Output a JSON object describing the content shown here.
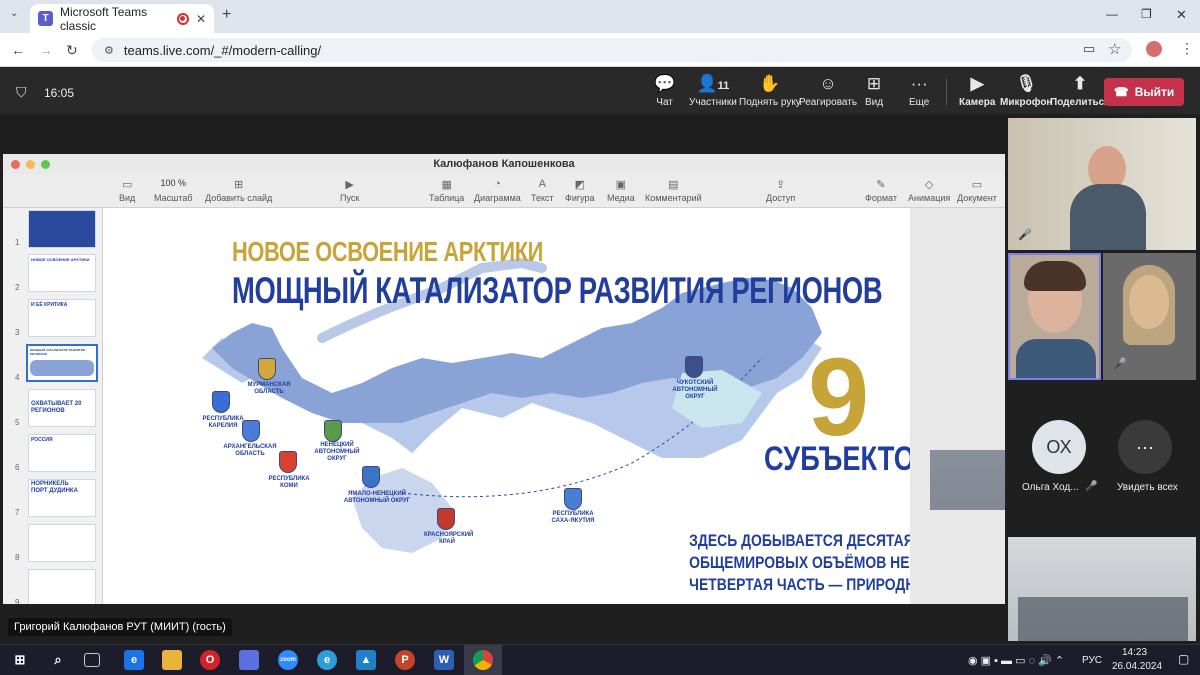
{
  "browser": {
    "tab_title": "Microsoft Teams classic",
    "new_tab": "+",
    "url": "teams.live.com/_#/modern-calling/"
  },
  "meeting": {
    "time": "16:05",
    "participants_count": "11",
    "controls": {
      "chat": "Чат",
      "participants": "Участники",
      "raise_hand": "Поднять руку",
      "react": "Реагировать",
      "view": "Вид",
      "more": "Еще",
      "camera": "Камера",
      "mic": "Микрофон",
      "share": "Поделиться",
      "leave": "Выйти"
    },
    "presenter_label": "Григорий Калюфанов РУТ (МИИТ) (гость)",
    "participants": {
      "initials": "ОХ",
      "name": "Ольга Ход...",
      "see_all": "Увидеть всех"
    }
  },
  "keynote": {
    "window_title": "Калюфанов Капошенкова",
    "zoom": "100 %",
    "toolbar": {
      "view": "Вид",
      "zoom_label": "Масштаб",
      "add_slide": "Добавить слайд",
      "play": "Пуск",
      "table": "Таблица",
      "chart": "Диаграмма",
      "text": "Текст",
      "shape": "Фигура",
      "media": "Медиа",
      "comment": "Комментарий",
      "share": "Доступ",
      "format": "Формат",
      "animate": "Анимация",
      "document": "Документ"
    },
    "slide_numbers": [
      "1",
      "2",
      "3",
      "4",
      "5",
      "6",
      "7",
      "8",
      "9"
    ],
    "thumbnails": {
      "t2": "НОВОЕ ОСВОЕНИЕ АРКТИКИ",
      "t3": "И ЕЁ КРИТИКА",
      "t4": "МОЩНЫЙ КАТАЛИЗАТОР РАЗВИТИЯ РЕГИОНОВ",
      "t5a": "ОХВАТЫВАЕТ 20",
      "t5b": "РЕГИОНОВ",
      "t6": "РОССИЯ",
      "t7a": "НОРНИКЕЛЬ",
      "t7b": "ПОРТ ДУДИНКА"
    }
  },
  "slide": {
    "heading1": "НОВОЕ ОСВОЕНИЕ АРКТИКИ",
    "heading2": "МОЩНЫЙ КАТАЛИЗАТОР РАЗВИТИЯ РЕГИОНОВ",
    "big_number": "9",
    "subjects": "СУБЪЕКТОВ",
    "fact_line1": "ЗДЕСЬ ДОБЫВАЕТСЯ ДЕСЯТАЯ ЧАСТЬ",
    "fact_line2": "ОБЩЕМИРОВЫХ ОБЪЁМОВ НЕФТИ И",
    "fact_line3": "ЧЕТВЕРТАЯ ЧАСТЬ — ПРИРОДНОГО ГАЗА",
    "regions": {
      "murmansk": "МУРМАНСКАЯ ОБЛАСТЬ",
      "karelia": "РЕСПУБЛИКА КАРЕЛИЯ",
      "arkhangelsk": "АРХАНГЕЛЬСКАЯ ОБЛАСТЬ",
      "komi": "РЕСПУБЛИКА КОМИ",
      "nenets": "НЕНЕЦКИЙ АВТОНОМНЫЙ ОКРУГ",
      "yamal": "ЯМАЛО-НЕНЕЦКИЙ АВТОНОМНЫЙ ОКРУГ",
      "krasnoyarsk": "КРАСНОЯРСКИЙ КРАЙ",
      "yakutia": "РЕСПУБЛИКА САХА-ЯКУТИЯ",
      "chukotka": "ЧУКОТСКИЙ АВТОНОМНЫЙ ОКРУГ"
    }
  },
  "taskbar": {
    "lang": "РУС",
    "clock_time": "14:23",
    "clock_date": "26.04.2024"
  },
  "colors": {
    "navy": "#223e9c",
    "gold": "#c7a437",
    "leave_red": "#c4314b",
    "map_blue": "#8aa3d6"
  }
}
